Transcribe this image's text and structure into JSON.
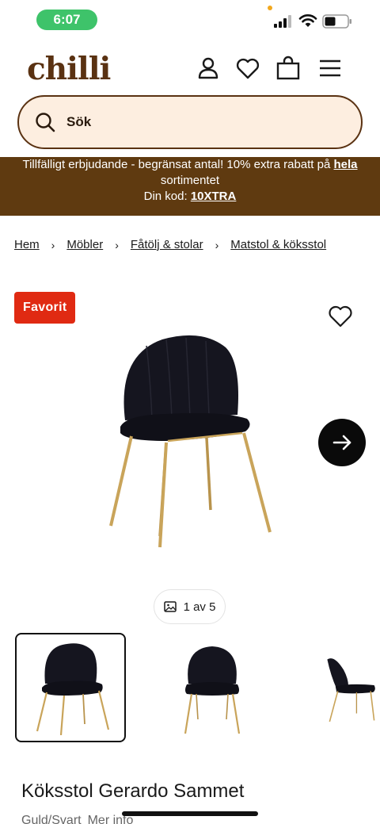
{
  "status_bar": {
    "time": "6:07"
  },
  "header": {
    "logo": "chilli",
    "icons": [
      "account-icon",
      "heart-icon",
      "bag-icon",
      "menu-icon"
    ]
  },
  "search": {
    "placeholder": "Sök"
  },
  "promo": {
    "text_before": "Tillfälligt erbjudande - begränsat antal! 10% extra rabatt på ",
    "link": "hela",
    "text_after": "sortimentet",
    "code_label": "Din kod: ",
    "code": "10XTRA",
    "background": "#5f3a10"
  },
  "breadcrumb": [
    {
      "label": "Hem"
    },
    {
      "label": "Möbler"
    },
    {
      "label": "Fåtölj & stolar"
    },
    {
      "label": "Matstol & köksstol"
    }
  ],
  "product": {
    "badge": "Favorit",
    "badge_color": "#e02a12",
    "image_counter": "1 av 5",
    "title": "Köksstol Gerardo Sammet",
    "variant": "Guld/Svart",
    "more_info": "Mer info"
  }
}
